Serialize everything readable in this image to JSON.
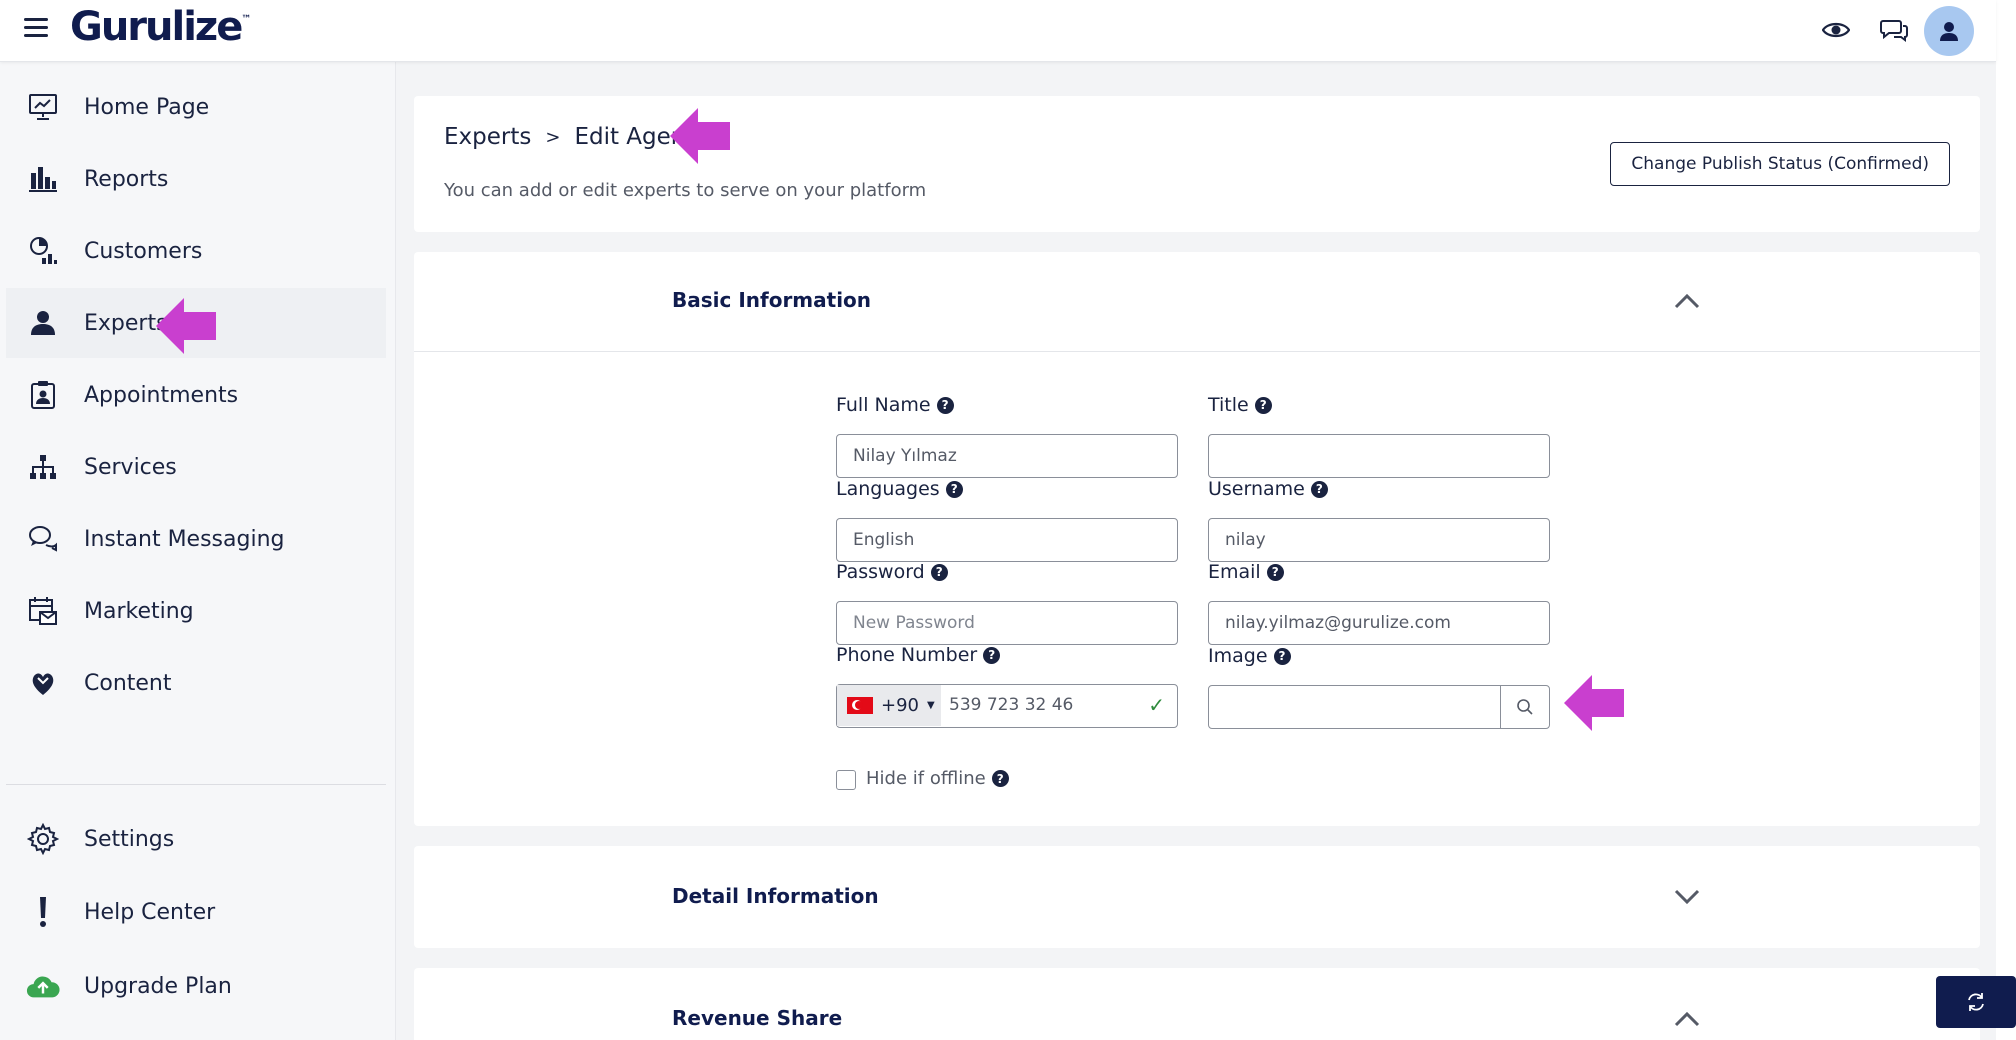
{
  "app": {
    "logo": "Gurulize",
    "logo_tm": "™"
  },
  "sidebar": {
    "items": [
      {
        "label": "Home Page",
        "icon": "monitor-chart-icon"
      },
      {
        "label": "Reports",
        "icon": "bar-chart-icon"
      },
      {
        "label": "Customers",
        "icon": "pie-chart-icon"
      },
      {
        "label": "Experts",
        "icon": "user-icon"
      },
      {
        "label": "Appointments",
        "icon": "clipboard-user-icon"
      },
      {
        "label": "Services",
        "icon": "hierarchy-icon"
      },
      {
        "label": "Instant Messaging",
        "icon": "chat-bubbles-icon"
      },
      {
        "label": "Marketing",
        "icon": "calendar-mail-icon"
      },
      {
        "label": "Content",
        "icon": "puzzle-heart-icon"
      }
    ],
    "bottom_items": [
      {
        "label": "Settings",
        "icon": "gear-icon"
      },
      {
        "label": "Help Center",
        "icon": "exclamation-icon"
      },
      {
        "label": "Upgrade Plan",
        "icon": "cloud-upload-icon"
      }
    ],
    "active": "Experts"
  },
  "header": {
    "breadcrumb_root": "Experts",
    "breadcrumb_sep": ">",
    "breadcrumb_current": "Edit Agent",
    "subtitle": "You can add or edit experts to serve on your platform",
    "publish_button": "Change Publish Status (Confirmed)"
  },
  "sections": {
    "basic": "Basic Information",
    "detail": "Detail Information",
    "revenue": "Revenue Share"
  },
  "form": {
    "full_name": {
      "label": "Full Name",
      "value": "Nilay Yılmaz"
    },
    "title": {
      "label": "Title",
      "value": ""
    },
    "languages": {
      "label": "Languages",
      "value": "English"
    },
    "username": {
      "label": "Username",
      "value": "nilay"
    },
    "password": {
      "label": "Password",
      "placeholder": "New Password"
    },
    "email": {
      "label": "Email",
      "value": "nilay.yilmaz@gurulize.com"
    },
    "phone": {
      "label": "Phone Number",
      "country_code": "+90",
      "value": "539 723 32 46",
      "valid_mark": "✓"
    },
    "image": {
      "label": "Image",
      "value": ""
    },
    "hide_offline": {
      "label": "Hide if offline",
      "checked": false
    }
  },
  "colors": {
    "brand": "#101c4e",
    "arrow": "#c93fcf",
    "valid": "#2e8b3d"
  }
}
